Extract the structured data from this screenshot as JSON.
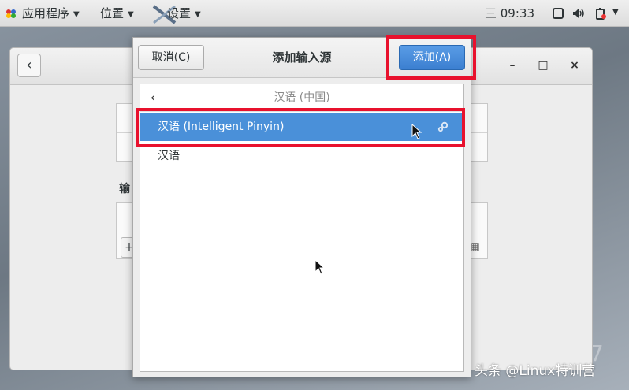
{
  "topbar": {
    "applications": "应用程序",
    "places": "位置",
    "settings": "设置",
    "clock": "三 09:33"
  },
  "background_window": {
    "section_label": "输",
    "add_button": "+"
  },
  "dialog": {
    "cancel": "取消(C)",
    "title": "添加输入源",
    "add": "添加(A)"
  },
  "list": {
    "header": "汉语 (中国)",
    "items": [
      {
        "label": "汉语 (Intelligent Pinyin)",
        "selected": true,
        "icon": "settings-gears-icon"
      },
      {
        "label": "汉语",
        "selected": false
      }
    ]
  },
  "watermark": "头条 @Linux特训营",
  "colors": {
    "highlight_box": "#e8112d",
    "selection": "#4a90d9",
    "primary_button": "#3b7fd0"
  }
}
